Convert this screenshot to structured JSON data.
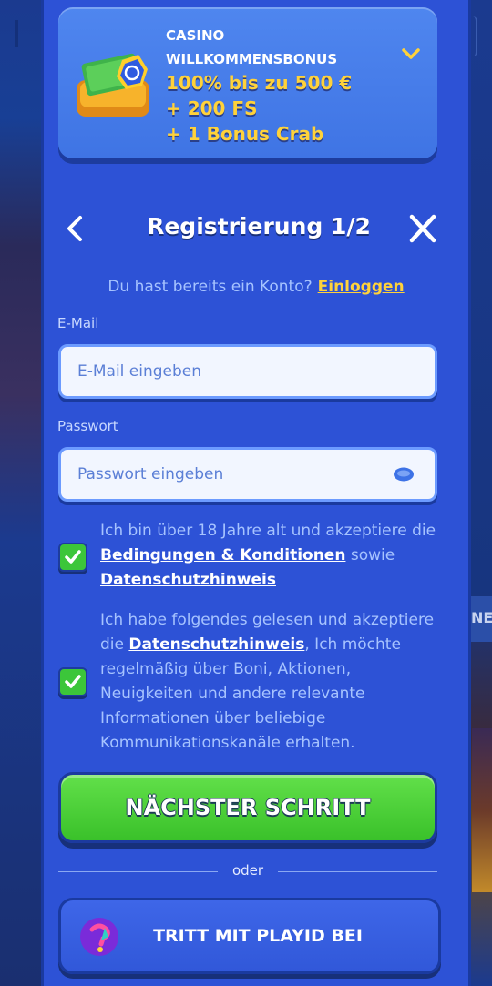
{
  "bonus": {
    "eyebrow_line1": "CASINO",
    "eyebrow_line2": "WILLKOMMENSBONUS",
    "line1": "100% bis zu 500 €",
    "line2": "+ 200 FS",
    "line3": "+ 1 Bonus Crab"
  },
  "header": {
    "title": "Registrierung 1/2"
  },
  "login": {
    "prompt": "Du hast bereits ein Konto?",
    "link": "Einloggen"
  },
  "email": {
    "label": "E-Mail",
    "placeholder": "E-Mail eingeben"
  },
  "password": {
    "label": "Passwort",
    "placeholder": "Passwort eingeben"
  },
  "consent1": {
    "checked": true,
    "text_a": "Ich bin über 18 Jahre alt und akzeptiere die",
    "link_a": "Bedingungen & Konditionen",
    "text_b": "sowie",
    "link_b": "Datenschutzhinweis"
  },
  "consent2": {
    "checked": true,
    "text_a": "Ich habe folgendes gelesen und akzeptiere die",
    "link_a": "Datenschutzhinweis",
    "text_b": ", Ich möchte regelmäßig über Boni, Aktionen, Neuigkeiten und andere relevante Informationen über beliebige Kommunikationskanäle erhalten."
  },
  "next_button": "NÄCHSTER SCHRITT",
  "divider": "oder",
  "playid_button": "TRITT MIT PLAYID BEI",
  "background": {
    "right_tab_text": "NE"
  },
  "colors": {
    "modal_bg": "#2d52d6",
    "accent_yellow": "#ffd23a",
    "primary_green": "#3ac12a"
  }
}
